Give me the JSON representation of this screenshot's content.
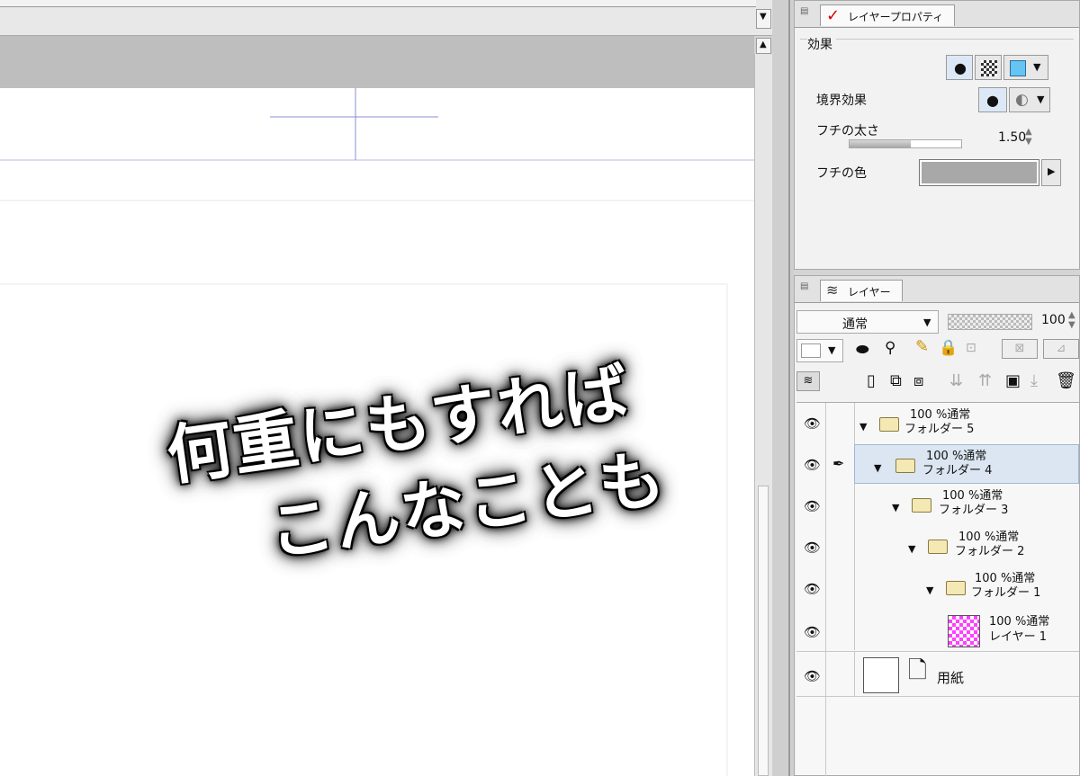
{
  "canvas": {
    "artwork_text_line1": "何重にもすれば",
    "artwork_text_line2": "こんなことも"
  },
  "property_panel": {
    "tab_label": "レイヤープロパティ",
    "effect_header": "効果",
    "border_effect_label": "境界効果",
    "border_width_label": "フチの太さ",
    "border_width_value": "1.50",
    "border_width_fill": 0.55,
    "border_color_label": "フチの色",
    "border_color": "#a8a8a8"
  },
  "layer_panel": {
    "tab_label": "レイヤー",
    "blend_mode": "通常",
    "opacity_value": "100",
    "layers": [
      {
        "opacity_mode": "100 %通常",
        "name": "フォルダー 5",
        "type": "folder"
      },
      {
        "opacity_mode": "100 %通常",
        "name": "フォルダー 4",
        "type": "folder",
        "selected": true
      },
      {
        "opacity_mode": "100 %通常",
        "name": "フォルダー 3",
        "type": "folder"
      },
      {
        "opacity_mode": "100 %通常",
        "name": "フォルダー 2",
        "type": "folder"
      },
      {
        "opacity_mode": "100 %通常",
        "name": "フォルダー 1",
        "type": "folder"
      },
      {
        "opacity_mode": "100 %通常",
        "name": "レイヤー 1",
        "type": "raster"
      }
    ],
    "paper_layer_name": "用紙"
  },
  "colors": {
    "selected_row": "#dbe6f2",
    "accent_red": "#d40000",
    "guide_blue": "#8c8cd8",
    "checker_pink": "#ff40ff"
  }
}
